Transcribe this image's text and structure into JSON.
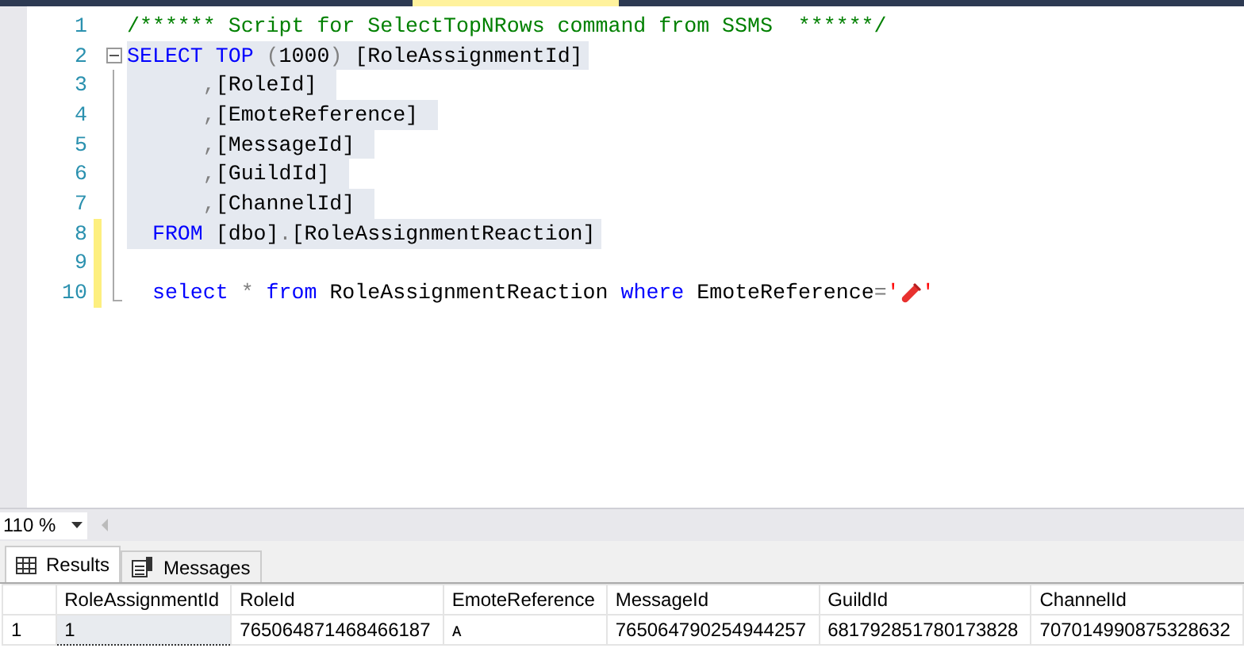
{
  "editor": {
    "lines": [
      {
        "number": "1",
        "selected": false,
        "changed": false,
        "collapsible": false,
        "tokens": [
          {
            "kind": "comment",
            "text": "/****** Script for SelectTopNRows command from SSMS  ******/"
          }
        ]
      },
      {
        "number": "2",
        "selected": true,
        "changed": false,
        "collapsible": true,
        "tokens": [
          {
            "kind": "keyword",
            "text": "SELECT TOP "
          },
          {
            "kind": "gray",
            "text": "("
          },
          {
            "kind": "plain",
            "text": "1000"
          },
          {
            "kind": "gray",
            "text": ")"
          },
          {
            "kind": "plain",
            "text": " [RoleAssignmentId]"
          }
        ]
      },
      {
        "number": "3",
        "selected": true,
        "changed": false,
        "collapsible": false,
        "tokens": [
          {
            "kind": "gray",
            "text": "      ,"
          },
          {
            "kind": "plain",
            "text": "[RoleId] "
          }
        ]
      },
      {
        "number": "4",
        "selected": true,
        "changed": false,
        "collapsible": false,
        "tokens": [
          {
            "kind": "gray",
            "text": "      ,"
          },
          {
            "kind": "plain",
            "text": "[EmoteReference] "
          }
        ]
      },
      {
        "number": "5",
        "selected": true,
        "changed": false,
        "collapsible": false,
        "tokens": [
          {
            "kind": "gray",
            "text": "      ,"
          },
          {
            "kind": "plain",
            "text": "[MessageId] "
          }
        ]
      },
      {
        "number": "6",
        "selected": true,
        "changed": false,
        "collapsible": false,
        "tokens": [
          {
            "kind": "gray",
            "text": "      ,"
          },
          {
            "kind": "plain",
            "text": "[GuildId] "
          }
        ]
      },
      {
        "number": "7",
        "selected": true,
        "changed": false,
        "collapsible": false,
        "tokens": [
          {
            "kind": "gray",
            "text": "      ,"
          },
          {
            "kind": "plain",
            "text": "[ChannelId] "
          }
        ]
      },
      {
        "number": "8",
        "selected": true,
        "changed": true,
        "collapsible": false,
        "tokens": [
          {
            "kind": "keyword",
            "text": "  FROM "
          },
          {
            "kind": "plain",
            "text": "[dbo]"
          },
          {
            "kind": "gray",
            "text": "."
          },
          {
            "kind": "plain",
            "text": "[RoleAssignmentReaction]"
          }
        ]
      },
      {
        "number": "9",
        "selected": false,
        "changed": true,
        "collapsible": false
      },
      {
        "number": "10",
        "selected": false,
        "changed": true,
        "collapsible": false,
        "tokens": [
          {
            "kind": "keyword",
            "text": "  select "
          },
          {
            "kind": "gray",
            "text": "* "
          },
          {
            "kind": "keyword",
            "text": "from "
          },
          {
            "kind": "plain",
            "text": "RoleAssignmentReaction "
          },
          {
            "kind": "keyword",
            "text": "where "
          },
          {
            "kind": "plain",
            "text": "EmoteReference"
          },
          {
            "kind": "gray",
            "text": "="
          },
          {
            "kind": "string",
            "text": "'"
          },
          {
            "kind": "emoji"
          },
          {
            "kind": "string",
            "text": "'"
          }
        ]
      }
    ]
  },
  "zoom": {
    "value": "110 %"
  },
  "tabs": [
    {
      "label": "Results",
      "selected": true,
      "kind": "grid"
    },
    {
      "label": "Messages",
      "selected": false,
      "kind": "messages"
    }
  ],
  "grid": {
    "columns": [
      "RoleAssignmentId",
      "RoleId",
      "EmoteReference",
      "MessageId",
      "GuildId",
      "ChannelId"
    ],
    "rows": [
      {
        "number": "1",
        "cells": [
          {
            "text": "1",
            "selected": true
          },
          {
            "text": "765064871468466187",
            "selected": false
          },
          {
            "text": "ᴀ",
            "selected": false
          },
          {
            "text": "765064790254944257",
            "selected": false
          },
          {
            "text": "681792851780173828",
            "selected": false
          },
          {
            "text": "707014990875328632",
            "selected": false
          }
        ]
      }
    ]
  }
}
